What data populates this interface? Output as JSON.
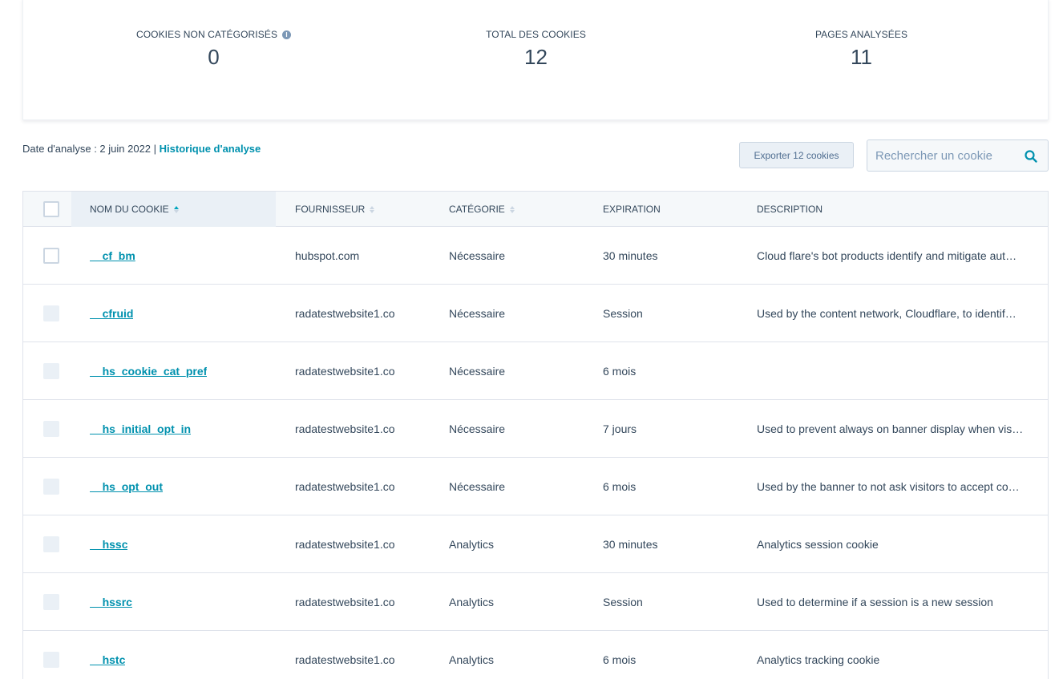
{
  "stats": [
    {
      "label": "COOKIES NON CATÉGORISÉS",
      "value": "0",
      "has_info": true
    },
    {
      "label": "TOTAL DES COOKIES",
      "value": "12",
      "has_info": false
    },
    {
      "label": "PAGES ANALYSÉES",
      "value": "11",
      "has_info": false
    }
  ],
  "analysis": {
    "date_text": "Date d'analyse : 2 juin 2022 | ",
    "history_link": "Historique d'analyse"
  },
  "toolbar": {
    "export_label": "Exporter 12 cookies",
    "search_placeholder": "Rechercher un cookie"
  },
  "table": {
    "columns": [
      "NOM DU COOKIE",
      "FOURNISSEUR",
      "CATÉGORIE",
      "EXPIRATION",
      "DESCRIPTION"
    ],
    "rows": [
      {
        "name": "__cf_bm",
        "provider": "hubspot.com",
        "category": "Nécessaire",
        "expiration": "30 minutes",
        "description": "Cloud flare's bot products identify and mitigate aut…",
        "enabled": true
      },
      {
        "name": "__cfruid",
        "provider": "radatestwebsite1.co",
        "category": "Nécessaire",
        "expiration": "Session",
        "description": "Used by the content network, Cloudflare, to identif…",
        "enabled": false
      },
      {
        "name": "__hs_cookie_cat_pref",
        "provider": "radatestwebsite1.co",
        "category": "Nécessaire",
        "expiration": "6 mois",
        "description": "",
        "enabled": false
      },
      {
        "name": "__hs_initial_opt_in",
        "provider": "radatestwebsite1.co",
        "category": "Nécessaire",
        "expiration": "7 jours",
        "description": "Used to prevent always on banner display when vis…",
        "enabled": false
      },
      {
        "name": "__hs_opt_out",
        "provider": "radatestwebsite1.co",
        "category": "Nécessaire",
        "expiration": "6 mois",
        "description": "Used by the banner to not ask visitors to accept co…",
        "enabled": false
      },
      {
        "name": "__hssc",
        "provider": "radatestwebsite1.co",
        "category": "Analytics",
        "expiration": "30 minutes",
        "description": "Analytics session cookie",
        "enabled": false
      },
      {
        "name": "__hssrc",
        "provider": "radatestwebsite1.co",
        "category": "Analytics",
        "expiration": "Session",
        "description": "Used to determine if a session is a new session",
        "enabled": false
      },
      {
        "name": "__hstc",
        "provider": "radatestwebsite1.co",
        "category": "Analytics",
        "expiration": "6 mois",
        "description": "Analytics tracking cookie",
        "enabled": false
      }
    ]
  },
  "colors": {
    "link": "#0091ae",
    "text": "#33475b",
    "border": "#dfe3eb",
    "header_bg": "#f5f8fa",
    "sorted_bg": "#eaf0f6"
  },
  "icons": {
    "info": "info-icon",
    "search": "search-icon",
    "sort": "sort-icon"
  }
}
